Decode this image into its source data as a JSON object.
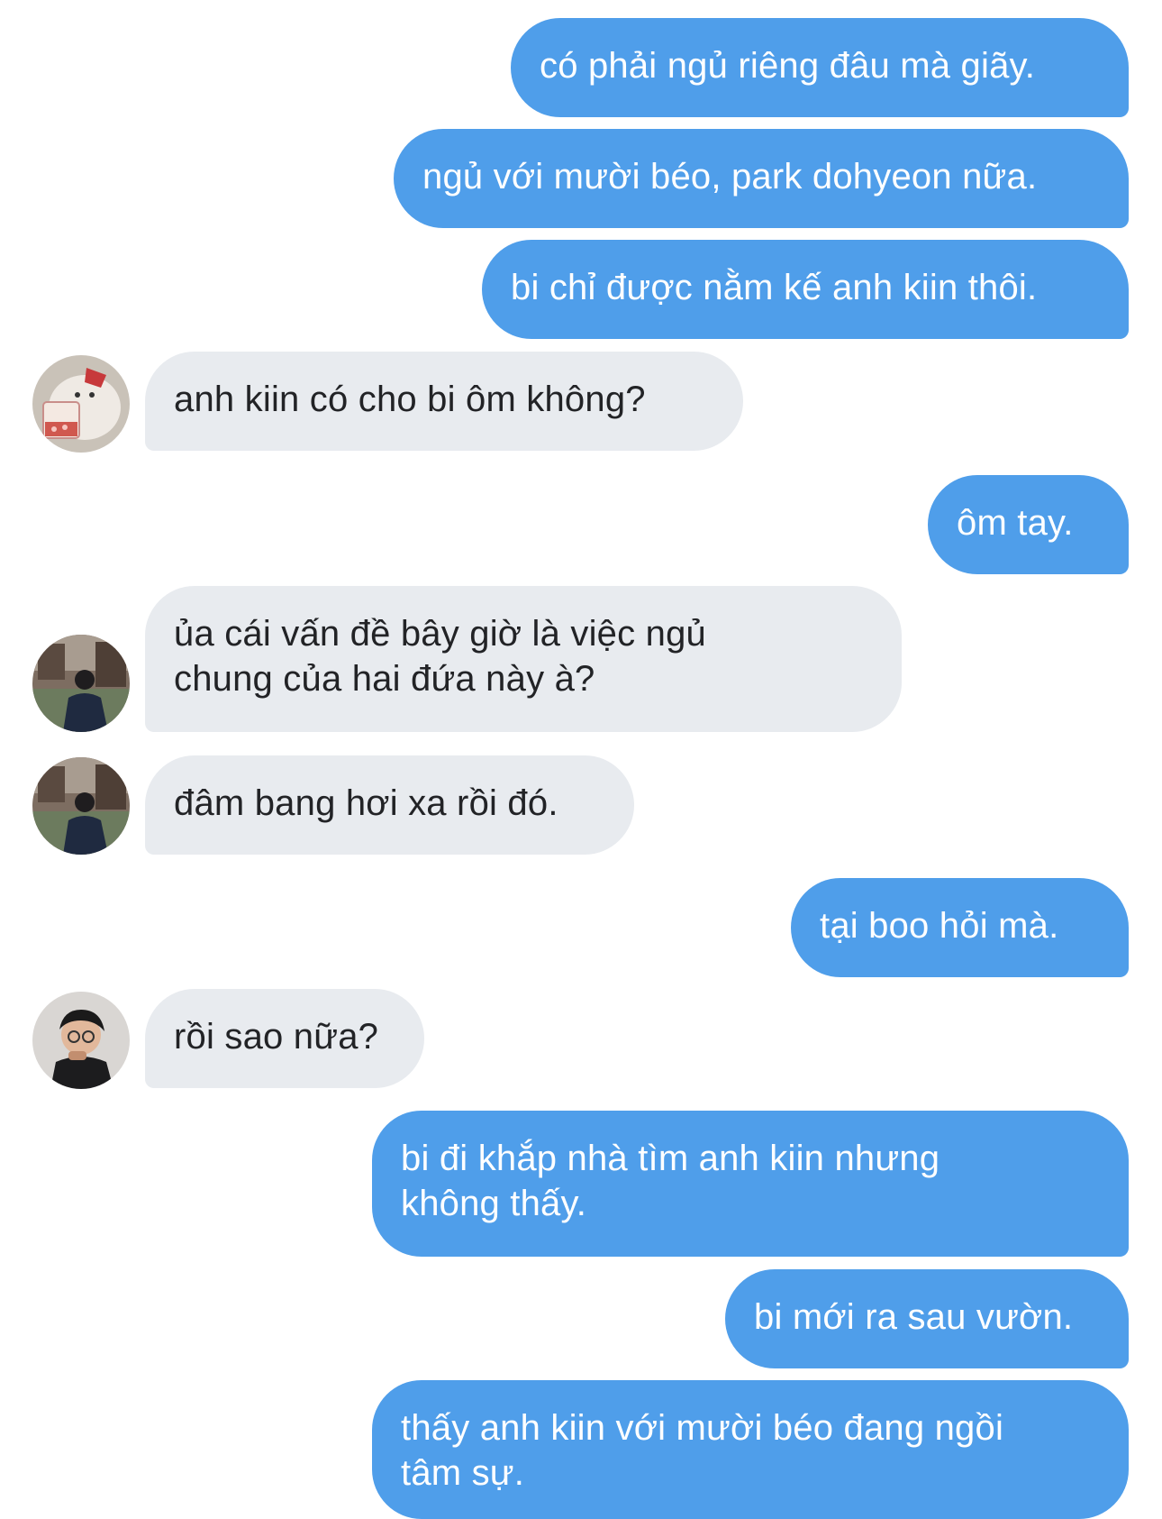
{
  "messages": [
    {
      "from": "me",
      "text": "có phải ngủ riêng đâu mà giãy."
    },
    {
      "from": "me",
      "text": "ngủ với mười béo, park dohyeon nữa."
    },
    {
      "from": "me",
      "text": "bi chỉ được nằm kế anh kiin thôi."
    },
    {
      "from": "them",
      "avatar": "bear-sticker-avatar",
      "text": "anh kiin có cho bi ôm không?"
    },
    {
      "from": "me",
      "text": "ôm tay."
    },
    {
      "from": "them",
      "avatar": "street-photo-avatar",
      "text": "ủa cái vấn đề bây giờ là việc ngủ\nchung của hai đứa này à?"
    },
    {
      "from": "them",
      "avatar": "street-photo-avatar",
      "text": "đâm bang hơi xa rồi đó."
    },
    {
      "from": "me",
      "text": "tại boo hỏi mà."
    },
    {
      "from": "them",
      "avatar": "boy-glasses-avatar",
      "text": "rồi sao nữa?"
    },
    {
      "from": "me",
      "text": "bi đi khắp nhà tìm anh kiin nhưng\nkhông thấy."
    },
    {
      "from": "me",
      "text": "bi mới ra sau vườn."
    },
    {
      "from": "me",
      "text": "thấy anh kiin với mười béo đang ngồi\ntâm sự."
    }
  ],
  "colors": {
    "outgoing_bubble": "#4f9eea",
    "incoming_bubble": "#e8ebef",
    "incoming_text": "#222326",
    "outgoing_text": "#ffffff"
  }
}
